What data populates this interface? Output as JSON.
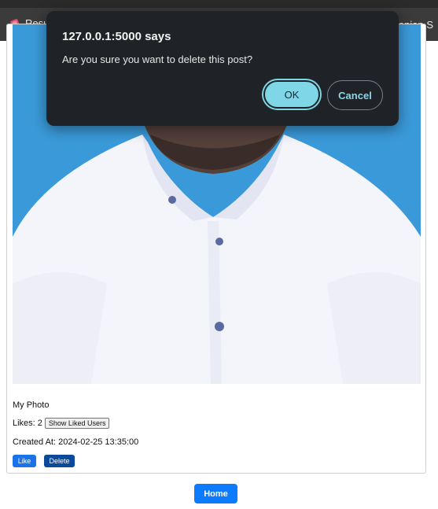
{
  "browser": {
    "tab_left_text": "Resu",
    "tab_right_text": "manian S"
  },
  "dialog": {
    "title": "127.0.0.1:5000 says",
    "message": "Are you sure you want to delete this post?",
    "ok_label": "OK",
    "cancel_label": "Cancel"
  },
  "post": {
    "caption": "My Photo",
    "likes_label": "Likes: 2",
    "show_liked_label": "Show Liked Users",
    "created_label": "Created At: 2024-02-25 13:35:00",
    "like_button": "Like",
    "delete_button": "Delete"
  },
  "footer": {
    "home_button": "Home"
  },
  "colors": {
    "photo_background": "#3a9ad9",
    "primary_button": "#1a73e8",
    "delete_button": "#0b4a9a",
    "dialog_background": "#1f2327",
    "dialog_accent": "#7ed6e6"
  }
}
